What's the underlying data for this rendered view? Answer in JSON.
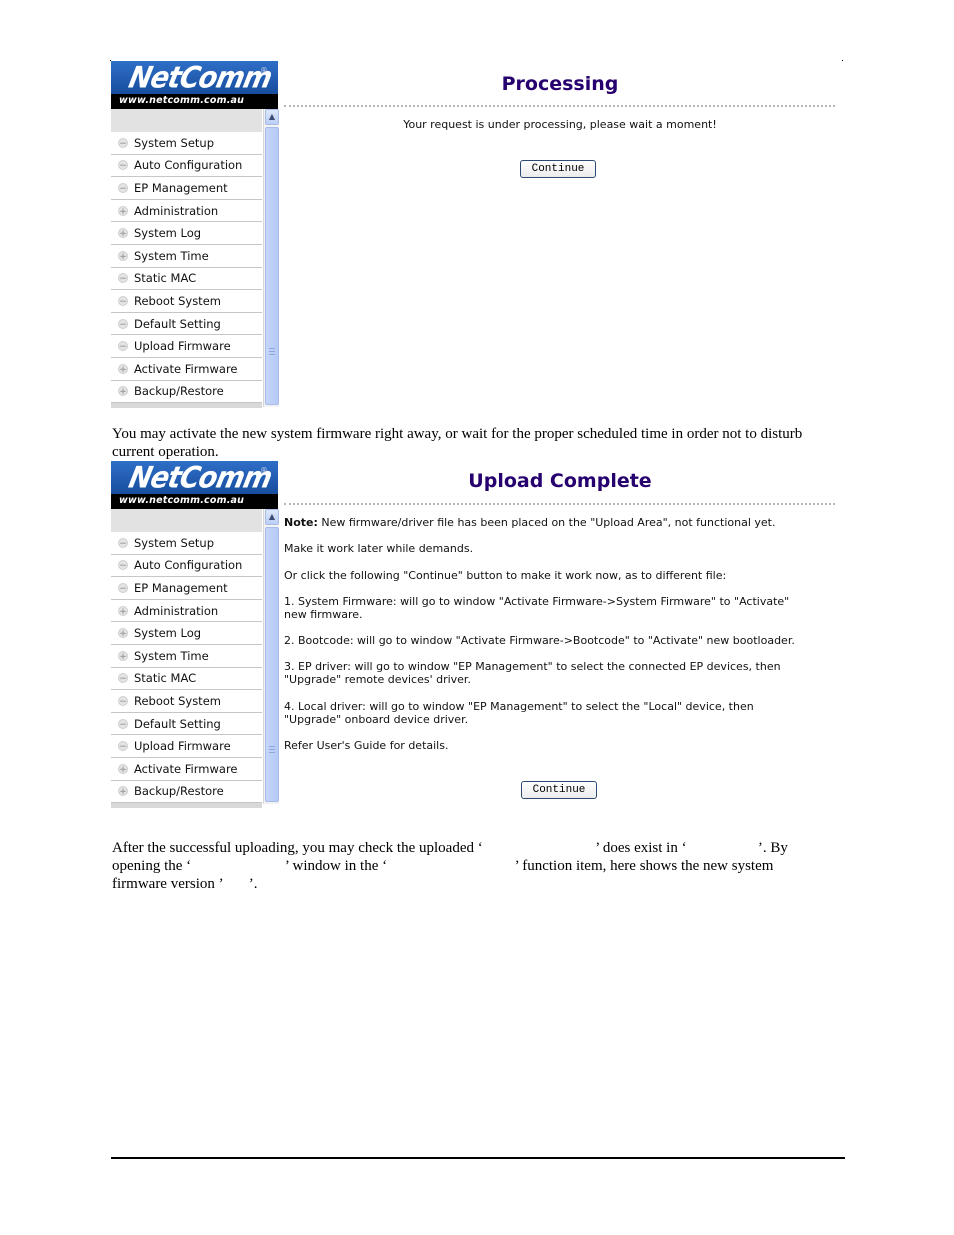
{
  "logo": {
    "brand": "NetComm",
    "registered": "®",
    "url": "www.netcomm.com.au"
  },
  "menu": {
    "items": [
      {
        "label": "System Setup",
        "state": "collapsed"
      },
      {
        "label": "Auto Configuration",
        "state": "collapsed"
      },
      {
        "label": "EP Management",
        "state": "collapsed"
      },
      {
        "label": "Administration",
        "state": "expandable"
      },
      {
        "label": "System Log",
        "state": "expandable"
      },
      {
        "label": "System Time",
        "state": "expandable"
      },
      {
        "label": "Static MAC",
        "state": "collapsed"
      },
      {
        "label": "Reboot System",
        "state": "collapsed"
      },
      {
        "label": "Default Setting",
        "state": "collapsed"
      },
      {
        "label": "Upload Firmware",
        "state": "collapsed"
      },
      {
        "label": "Activate Firmware",
        "state": "expandable"
      },
      {
        "label": "Backup/Restore",
        "state": "expandable"
      }
    ],
    "bullet_minus": "−",
    "bullet_plus": "+"
  },
  "screenshot1": {
    "title": "Processing",
    "message": "Your request is under processing, please wait a moment!",
    "continue_label": "Continue"
  },
  "middle_text": "You may activate the new system firmware right away, or wait for the proper scheduled time in order not to disturb current operation.",
  "screenshot2": {
    "title": "Upload Complete",
    "note_label": "Note:",
    "note_text": " New firmware/driver file has been placed on the \"Upload Area\", not functional yet.",
    "lines": [
      "Make it work later while demands.",
      "Or click the following \"Continue\" button to make it work now, as to different file:",
      "1. System Firmware: will go to window \"Activate Firmware->System Firmware\" to \"Activate\"",
      "new firmware.",
      "2. Bootcode: will go to window \"Activate Firmware->Bootcode\" to \"Activate\" new bootloader.",
      "3. EP driver: will go to window \"EP Management\" to select the connected EP devices, then",
      "\"Upgrade\" remote devices' driver.",
      "4. Local driver: will go to window \"EP Management\" to select the \"Local\" device, then",
      "\"Upgrade\" onboard device driver.",
      "Refer User's Guide for details."
    ],
    "continue_label": "Continue"
  },
  "bottom_text": {
    "line1": "After the successful uploading, you may check the uploaded ‘                              ’ does exist in ‘                   ’. By",
    "line2": "opening the ‘                         ’ window in the ‘                                  ’ function item, here shows the new system",
    "line3": "firmware version ’       ’."
  }
}
